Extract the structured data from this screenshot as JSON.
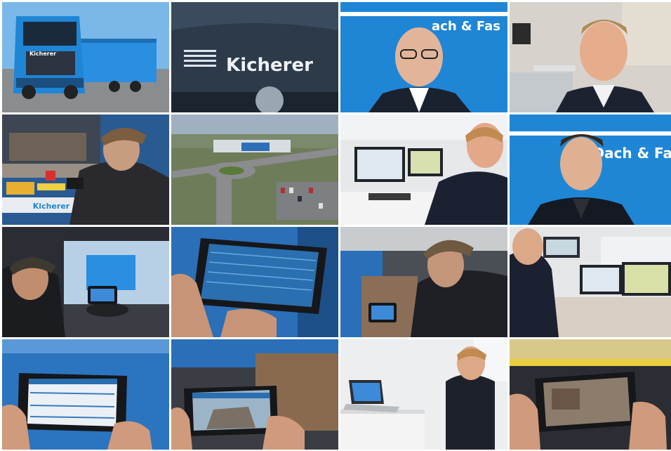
{
  "collage": {
    "tiles": [
      {
        "id": "truck-front-blue",
        "text": "Kicherer"
      },
      {
        "id": "truck-grille-logo",
        "text": "Kicherer"
      },
      {
        "id": "man-glasses-blue-sign",
        "text": "ach & Fas"
      },
      {
        "id": "man-smiling-office",
        "text": ""
      },
      {
        "id": "driver-cap-at-trailer",
        "text": "Kicherer"
      },
      {
        "id": "aerial-roundabout",
        "text": ""
      },
      {
        "id": "man-at-monitors",
        "text": ""
      },
      {
        "id": "young-man-blue-sign",
        "text": "Dach & Fa"
      },
      {
        "id": "driver-in-cab-tablet",
        "text": ""
      },
      {
        "id": "tablet-list-closeup",
        "text": ""
      },
      {
        "id": "driver-tablet-in-trailer",
        "text": ""
      },
      {
        "id": "man-dispatch-desk",
        "text": ""
      },
      {
        "id": "tablet-held-hands",
        "text": ""
      },
      {
        "id": "phone-photo-cargo",
        "text": ""
      },
      {
        "id": "man-laptop-desk",
        "text": ""
      },
      {
        "id": "tablet-photo-hands",
        "text": ""
      }
    ]
  },
  "colors": {
    "brand_blue": "#1f86d6",
    "dark": "#1d1f24",
    "sky": "#6fb3ea"
  }
}
